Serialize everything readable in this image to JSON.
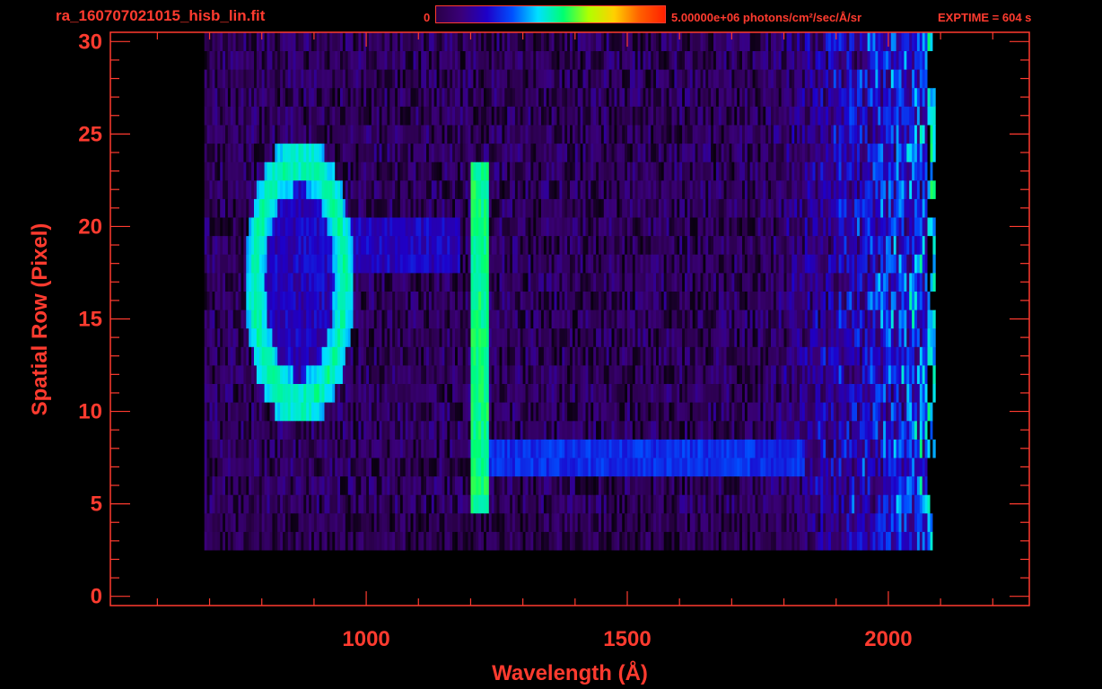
{
  "header": {
    "filename": "ra_160707021015_hisb_lin.fit",
    "colorbar_min": "0",
    "colorbar_max": "5.00000e+06 photons/cm²/sec/Å/sr",
    "exptime": "EXPTIME = 604 s"
  },
  "colors": {
    "axis": "#ff3b2f",
    "background": "#000000",
    "colormap": [
      "#000000",
      "#2a0048",
      "#3a007a",
      "#1e00c8",
      "#0050ff",
      "#00e0ff",
      "#00ff70",
      "#b0ff00",
      "#ffd000",
      "#ff6000",
      "#ff2000"
    ]
  },
  "chart_data": {
    "type": "heatmap",
    "title": "",
    "xlabel": "Wavelength (Å)",
    "ylabel": "Spatial Row (Pixel)",
    "xlim": [
      510,
      2270
    ],
    "ylim": [
      -0.5,
      30.5
    ],
    "xticks": [
      1000,
      1500,
      2000
    ],
    "yticks": [
      0,
      5,
      10,
      15,
      20,
      25,
      30
    ],
    "x_minor_step": 100,
    "y_minor_step": 1,
    "colorbar": {
      "min": 0,
      "max": 5000000,
      "units": "photons/cm²/sec/Å/sr"
    },
    "data_extent": {
      "x": [
        690,
        2090
      ],
      "rows": [
        3,
        30
      ]
    },
    "features": [
      {
        "name": "Ly-beta ring",
        "x_center": 870,
        "row_center": 17,
        "x_radius": 85,
        "row_radius": 6.5,
        "level": 0.55
      },
      {
        "name": "Ly-alpha line",
        "x": 1216,
        "rows": [
          5,
          23
        ],
        "level": 0.55
      },
      {
        "name": "slit row band",
        "x": [
          1216,
          1840
        ],
        "rows": [
          7,
          8
        ],
        "level": 0.32
      },
      {
        "name": "red continuum edge",
        "x": [
          1900,
          2070
        ],
        "rows": [
          3,
          30
        ],
        "level": 0.45
      }
    ]
  }
}
